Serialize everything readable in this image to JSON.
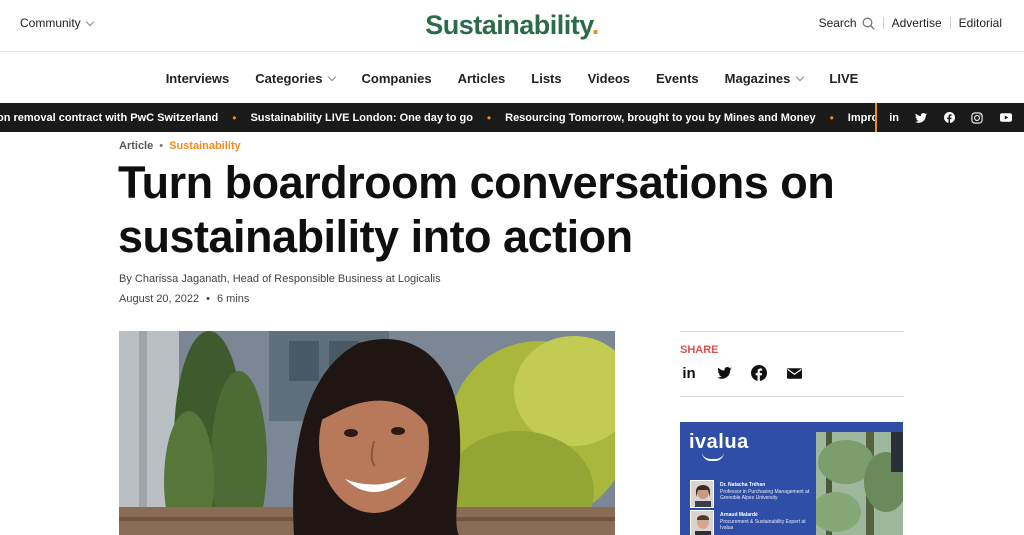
{
  "topbar": {
    "community_label": "Community",
    "logo_word": "Sustainability",
    "logo_dot": ".",
    "search_label": "Search",
    "advertise_label": "Advertise",
    "editorial_label": "Editorial"
  },
  "nav": {
    "items": [
      {
        "label": "Interviews",
        "dropdown": false
      },
      {
        "label": "Categories",
        "dropdown": true
      },
      {
        "label": "Companies",
        "dropdown": false
      },
      {
        "label": "Articles",
        "dropdown": false
      },
      {
        "label": "Lists",
        "dropdown": false
      },
      {
        "label": "Videos",
        "dropdown": false
      },
      {
        "label": "Events",
        "dropdown": false
      },
      {
        "label": "Magazines",
        "dropdown": true
      },
      {
        "label": "LIVE",
        "dropdown": false
      }
    ]
  },
  "ticker": {
    "items": [
      "rbon removal contract with PwC Switzerland",
      "Sustainability LIVE London: One day to go",
      "Resourcing Tomorrow, brought to you by Mines and Money",
      "Improving a"
    ],
    "social": [
      "linkedin-icon",
      "twitter-icon",
      "facebook-icon",
      "instagram-icon",
      "youtube-icon"
    ]
  },
  "article": {
    "type_label": "Article",
    "category_label": "Sustainability",
    "title": "Turn boardroom conversations on sustainability into action",
    "byline": "By Charissa Jaganath, Head of Responsible Business at Logicalis",
    "date": "August 20, 2022",
    "read_time": "6 mins"
  },
  "share": {
    "label": "SHARE",
    "icons": [
      "linkedin-icon",
      "twitter-icon",
      "facebook-icon",
      "email-icon"
    ]
  },
  "ad": {
    "brand": "ivalua",
    "people": [
      {
        "name": "Dr. Natacha Tréhan",
        "role": "Professor in Purchasing Management at Grenoble Alpes University"
      },
      {
        "name": "Arnaud Malardé",
        "role": "Procurement & Sustainability Expert at Ivalua"
      }
    ]
  },
  "colors": {
    "brand_green": "#2c6b4a",
    "accent_orange": "#f28c1e",
    "share_red": "#d9534f",
    "ticker_bg": "#1a1a1a",
    "ad_blue": "#2f4ea8"
  }
}
